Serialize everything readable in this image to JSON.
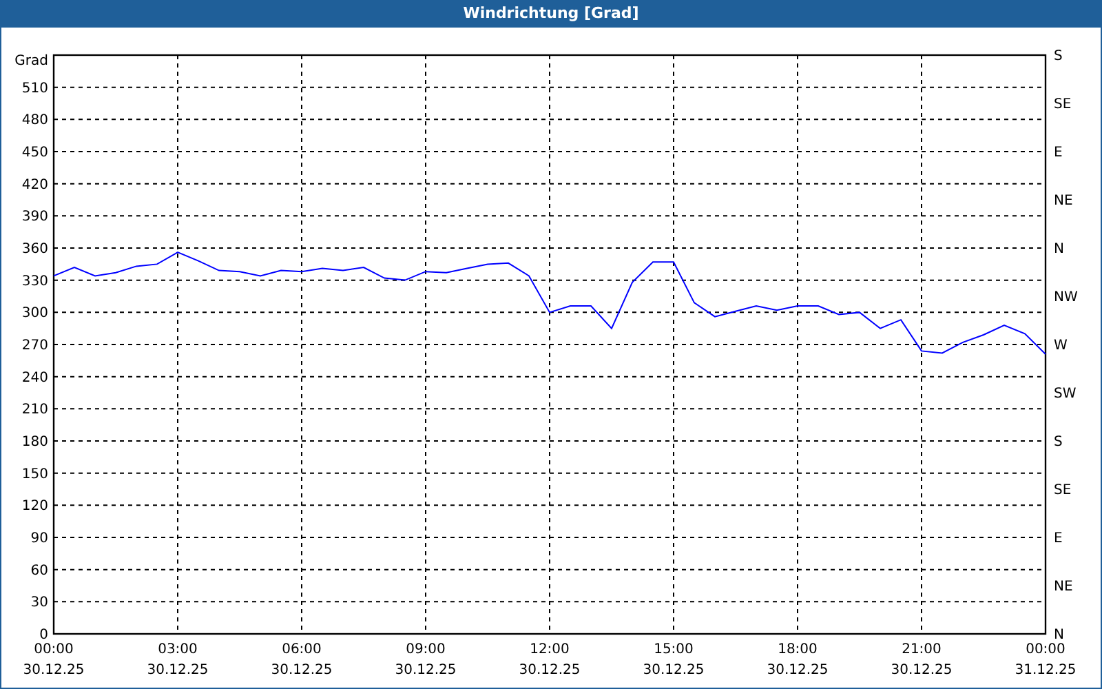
{
  "window": {
    "title": "Windrichtung [Grad]"
  },
  "chart": {
    "chart_data": {
      "type": "line",
      "ylabel": "Grad",
      "categories": [
        "00:00",
        null,
        null,
        null,
        null,
        null,
        "03:00",
        null,
        null,
        null,
        null,
        null,
        "06:00",
        null,
        null,
        null,
        null,
        null,
        "09:00",
        null,
        null,
        null,
        null,
        null,
        "12:00",
        null,
        null,
        null,
        null,
        null,
        "15:00",
        null,
        null,
        null,
        null,
        null,
        "18:00",
        null,
        null,
        null,
        null,
        null,
        "21:00",
        null,
        null,
        null,
        null,
        null,
        "00:00"
      ],
      "series": [
        {
          "color": "#0000ff",
          "values": [
            334,
            342,
            334,
            337,
            343,
            345,
            356,
            348,
            339,
            338,
            334,
            339,
            338,
            341,
            339,
            342,
            332,
            330,
            338,
            337,
            341,
            345,
            346,
            334,
            300,
            306,
            306,
            285,
            328,
            347,
            347,
            309,
            296,
            301,
            306,
            302,
            306,
            306,
            298,
            300,
            285,
            293,
            264,
            262,
            272,
            279,
            288,
            280,
            261
          ]
        }
      ],
      "ylim": [
        0,
        540
      ],
      "grid": true,
      "yticks": [
        0,
        30,
        60,
        90,
        120,
        150,
        180,
        210,
        240,
        270,
        300,
        330,
        360,
        390,
        420,
        450,
        480,
        510
      ]
    },
    "dates": [
      "30.12.25",
      "30.12.25",
      "30.12.25",
      "30.12.25",
      "30.12.25",
      "30.12.25",
      "30.12.25",
      "30.12.25",
      "31.12.25"
    ],
    "compass_labels": [
      "S",
      "SE",
      "E",
      "NE",
      "N",
      "NW",
      "W",
      "SW",
      "S",
      "SE",
      "E",
      "NE",
      "N"
    ]
  }
}
